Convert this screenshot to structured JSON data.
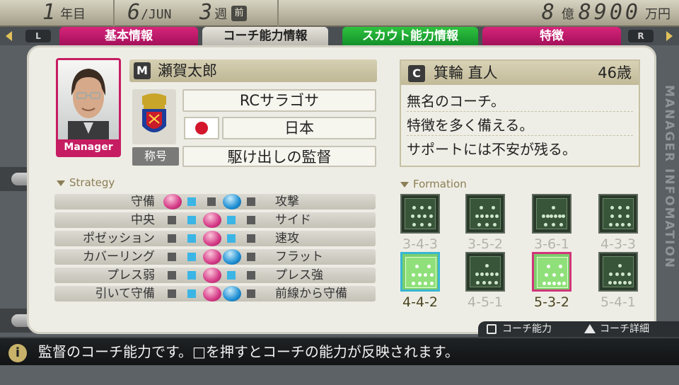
{
  "topbar": {
    "year_num": "1",
    "year_unit": "年目",
    "month_num": "6",
    "month_name": "/JUN",
    "week_num": "3",
    "week_unit": "週",
    "week_badge": "前",
    "money_oku": "8",
    "money_oku_unit": "億",
    "money_man": "8900",
    "money_man_unit": "万円"
  },
  "tabs": {
    "left_button": "L",
    "right_button": "R",
    "items": [
      "基本情報",
      "コーチ能力情報",
      "スカウト能力情報",
      "特徴"
    ]
  },
  "manager": {
    "portrait_label": "Manager",
    "name_badge": "M",
    "name": "瀬賀太郎",
    "club": "RCサラゴサ",
    "nation": "日本",
    "title_tag": "称号",
    "title": "駆け出しの監督"
  },
  "coach": {
    "badge": "C",
    "name": "箕輪 直人",
    "age": "46歳",
    "lines": [
      "無名のコーチ。",
      "特徴を多く備える。",
      "サポートには不安が残る。"
    ]
  },
  "strategy": {
    "header": "Strategy",
    "rows": [
      {
        "left": "守備",
        "right": "攻撃",
        "pink": 1,
        "blue": 4
      },
      {
        "left": "中央",
        "right": "サイド",
        "pink": 3,
        "blue": null
      },
      {
        "left": "ポゼッション",
        "right": "速攻",
        "pink": 3,
        "blue": null
      },
      {
        "left": "カバーリング",
        "right": "フラット",
        "pink": 3,
        "blue": 4
      },
      {
        "left": "プレス弱",
        "right": "プレス強",
        "pink": 3,
        "blue": null
      },
      {
        "left": "引いて守備",
        "right": "前線から守備",
        "pink": 3,
        "blue": 4
      }
    ]
  },
  "formation": {
    "header": "Formation",
    "items": [
      {
        "label": "3-4-3",
        "state": "normal"
      },
      {
        "label": "3-5-2",
        "state": "normal"
      },
      {
        "label": "3-6-1",
        "state": "normal"
      },
      {
        "label": "4-3-3",
        "state": "normal"
      },
      {
        "label": "4-4-2",
        "state": "selected"
      },
      {
        "label": "4-5-1",
        "state": "normal"
      },
      {
        "label": "5-3-2",
        "state": "selected"
      },
      {
        "label": "5-4-1",
        "state": "normal"
      }
    ]
  },
  "side_label": "MANAGER INFOMATION",
  "buttons": {
    "square_label": "コーチ能力",
    "triangle_label": "コーチ詳細"
  },
  "help": {
    "icon": "i",
    "text": "監督のコーチ能力です。□を押すとコーチの能力が反映されます。"
  },
  "colors": {
    "pink": "#c61c62",
    "green": "#1fa838",
    "cyan": "#17b8d4"
  }
}
